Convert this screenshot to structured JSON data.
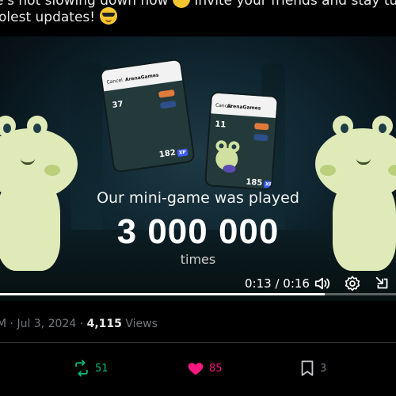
{
  "tweet": {
    "line1_text": "e's not slowing down now",
    "line1_tail": "Invite your friends and stay tune",
    "line2_text": "olest updates!",
    "emoji_wink": "smile-emoji",
    "emoji_cool": "sunglasses-emoji"
  },
  "video": {
    "caption_top": "Our mini-game was played",
    "caption_big": "3 000 000",
    "caption_bottom": "times",
    "phone_left": {
      "cancel": "Cancel",
      "app": "ArenaGames",
      "score": "37",
      "xp": "182",
      "xp_badge": "XP"
    },
    "phone_right": {
      "cancel": "Cancel",
      "app": "ArenaGames",
      "score": "11",
      "xp": "185",
      "xp_badge": "XP"
    },
    "time": "0:13 / 0:16",
    "progress": 0.82,
    "icons": [
      "volume-icon",
      "settings-icon",
      "exit-fullscreen-icon"
    ]
  },
  "meta": {
    "time_partial": "M",
    "date": "Jul 3, 2024",
    "views_count": "4,115",
    "views_label": "Views"
  },
  "actions": {
    "retweets": "51",
    "likes": "85",
    "bookmarks": "3"
  },
  "colors": {
    "retweet": "#00ba7c",
    "like": "#f91880",
    "muted": "#71767b"
  }
}
